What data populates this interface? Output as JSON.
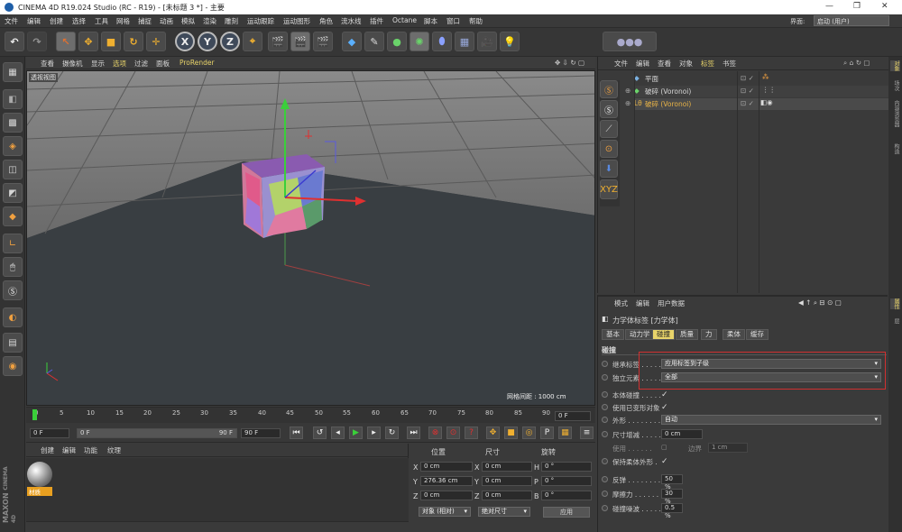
{
  "window": {
    "title": "CINEMA 4D R19.024 Studio (RC - R19) - [未标题 3 *] - 主要",
    "controls": [
      "—",
      "❐",
      "✕"
    ]
  },
  "menu": [
    "文件",
    "编辑",
    "创建",
    "选择",
    "工具",
    "网格",
    "捕捉",
    "动画",
    "模拟",
    "渲染",
    "雕刻",
    "运动跟踪",
    "运动图形",
    "角色",
    "流水线",
    "插件",
    "Octane",
    "脚本",
    "窗口",
    "帮助"
  ],
  "layout": {
    "label": "界面:",
    "value": "启动 (用户)"
  },
  "toolbar": {
    "x_label": "X",
    "y_label": "Y",
    "z_label": "Z"
  },
  "viewport": {
    "menu": [
      "查看",
      "摄像机",
      "显示",
      "选项",
      "过滤",
      "面板",
      "ProRender"
    ],
    "label": "透视视图",
    "grid_spacing": "网格间距 : 1000 cm"
  },
  "timeline": {
    "ticks": [
      "0",
      "5",
      "10",
      "15",
      "20",
      "25",
      "30",
      "35",
      "40",
      "45",
      "50",
      "55",
      "60",
      "65",
      "70",
      "75",
      "80",
      "85",
      "90"
    ],
    "current_frame": "0 F"
  },
  "transport": {
    "start": "0 F",
    "min": "0 F",
    "max": "90 F",
    "end": "90 F"
  },
  "materials": {
    "menu": [
      "创建",
      "编辑",
      "功能",
      "纹理"
    ],
    "item_label": "材质",
    "brand_top": "MAXON",
    "brand_bottom": "CINEMA 4D"
  },
  "coords": {
    "headers": [
      "位置",
      "尺寸",
      "旋转"
    ],
    "rows": [
      {
        "axis": "X",
        "pos": "0 cm",
        "size_axis": "X",
        "size": "0 cm",
        "rot_axis": "H",
        "rot": "0 °"
      },
      {
        "axis": "Y",
        "pos": "276.36 cm",
        "size_axis": "Y",
        "size": "0 cm",
        "rot_axis": "P",
        "rot": "0 °"
      },
      {
        "axis": "Z",
        "pos": "0 cm",
        "size_axis": "Z",
        "size": "0 cm",
        "rot_axis": "B",
        "rot": "0 °"
      }
    ],
    "mode1": "对象 (相对)",
    "mode2": "绝对尺寸",
    "apply": "应用"
  },
  "objects": {
    "menu": [
      "文件",
      "编辑",
      "查看",
      "对象",
      "标签",
      "书签"
    ],
    "items": [
      {
        "name": "平面",
        "color": "#cfd8e6"
      },
      {
        "name": "破碎 (Voronoi)",
        "color": "#cfd8e6"
      },
      {
        "name": "破碎 (Voronoi)",
        "color": "#e8b347"
      }
    ]
  },
  "attributes": {
    "menu": [
      "模式",
      "编辑",
      "用户数据"
    ],
    "title": "力学体标签 [力学体]",
    "tabs": [
      "基本",
      "动力学",
      "碰撞",
      "质量",
      "力",
      "柔体",
      "缓存"
    ],
    "active_tab": "碰撞",
    "section": "碰撞",
    "rows": {
      "inherit": {
        "label": "继承标签 . . . . .",
        "value": "应用标签到子级"
      },
      "independent": {
        "label": "独立元素 . . . . .",
        "value": "全部"
      },
      "self_collision": {
        "label": "本体碰撞 . . . . .",
        "check": "✓"
      },
      "use_deformed": {
        "label": "使用已变形对象",
        "check": "✓"
      },
      "shape": {
        "label": "外形 . . . . . . . . .",
        "value": "自动"
      },
      "size_increment": {
        "label": "尺寸增减 . . . . .",
        "value": "0 cm"
      },
      "use": {
        "label": "使用 . . . . . .",
        "border_label": "边界",
        "border_value": "1 cm"
      },
      "keep_shape": {
        "label": "保持柔体外形 .",
        "check": "✓"
      },
      "bounce": {
        "label": "反弹 . . . . . . . . .",
        "value": "50 %"
      },
      "friction": {
        "label": "摩擦力 . . . . . . .",
        "value": "30 %"
      },
      "noise": {
        "label": "碰撞噪波 . . . . .",
        "value": "0.5 %"
      }
    }
  },
  "side_tabs": [
    "对象",
    "场次",
    "内容浏览器",
    "构造"
  ],
  "side_tabs2": [
    "属性",
    "层"
  ]
}
